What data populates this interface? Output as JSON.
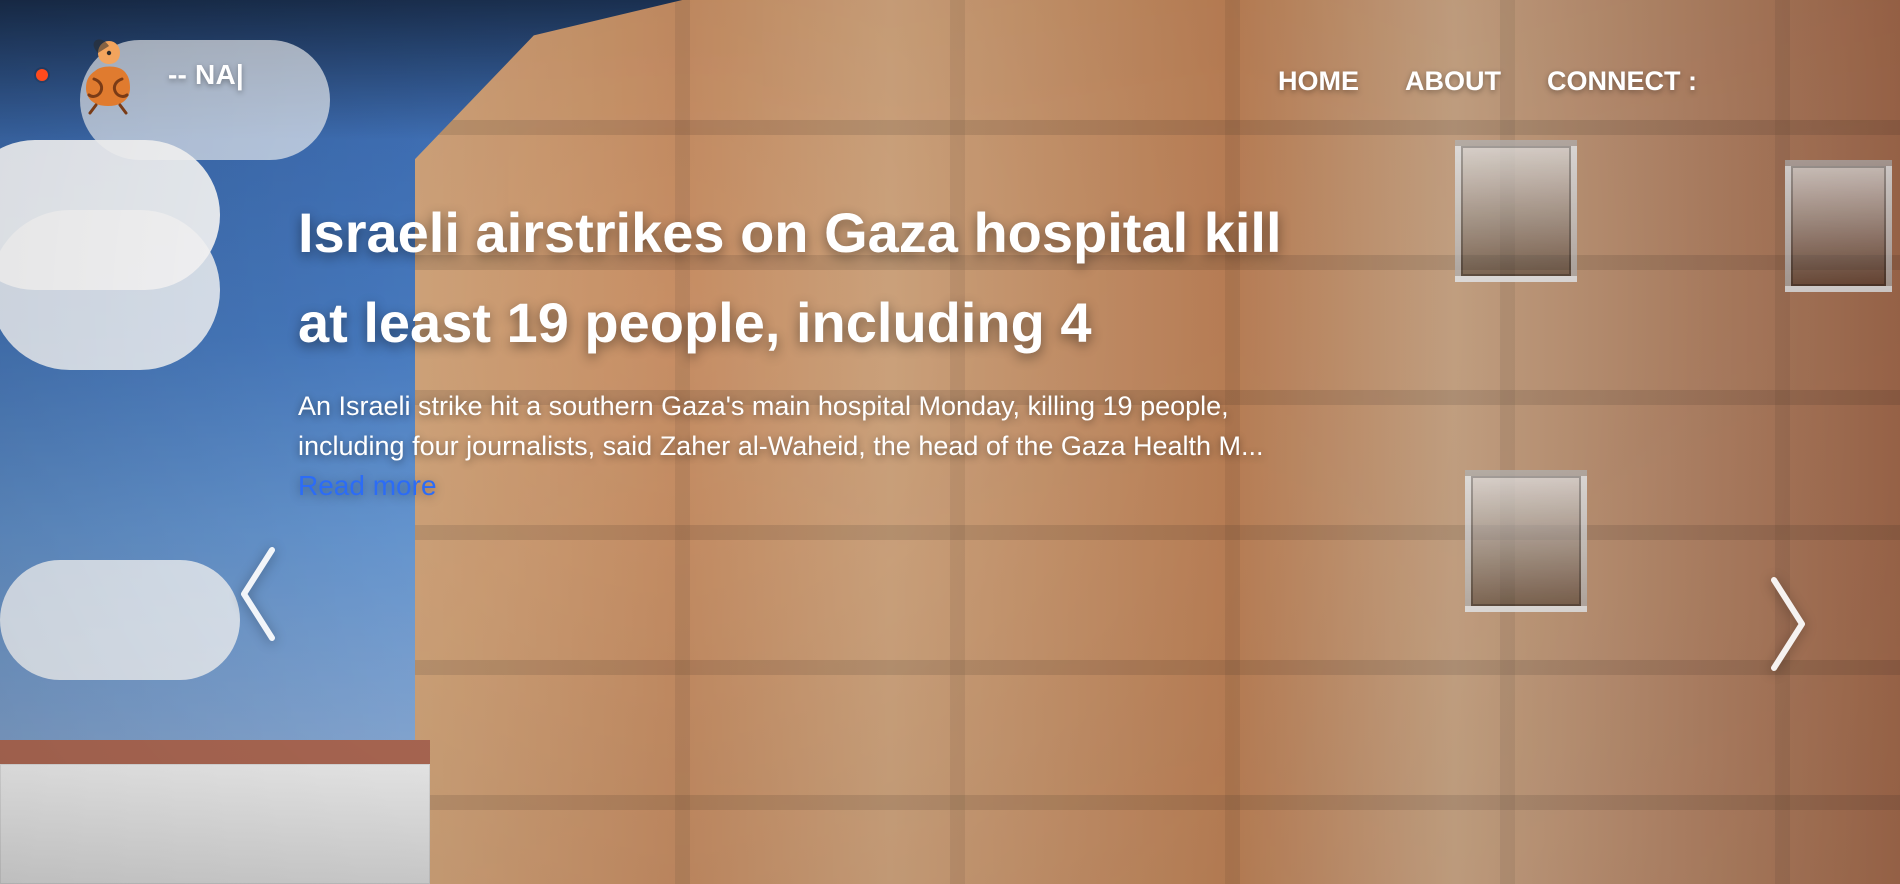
{
  "header": {
    "brand_text": "-- NA|",
    "nav": [
      {
        "label": "HOME"
      },
      {
        "label": "ABOUT"
      },
      {
        "label": "CONNECT :"
      }
    ],
    "status_dot_color": "#ff4a1c"
  },
  "hero": {
    "headline": "Israeli airstrikes on Gaza hospital kill at least 19 people, including 4",
    "summary": "An Israeli strike hit a southern Gaza's main hospital Monday, killing 19 people, including four journalists, said Zaher al-Waheid, the head of the Gaza Health M...",
    "read_more_label": "Read more",
    "read_more_color": "#2c6cf6"
  },
  "carousel": {
    "prev_icon": "chevron-left-icon",
    "next_icon": "chevron-right-icon"
  }
}
